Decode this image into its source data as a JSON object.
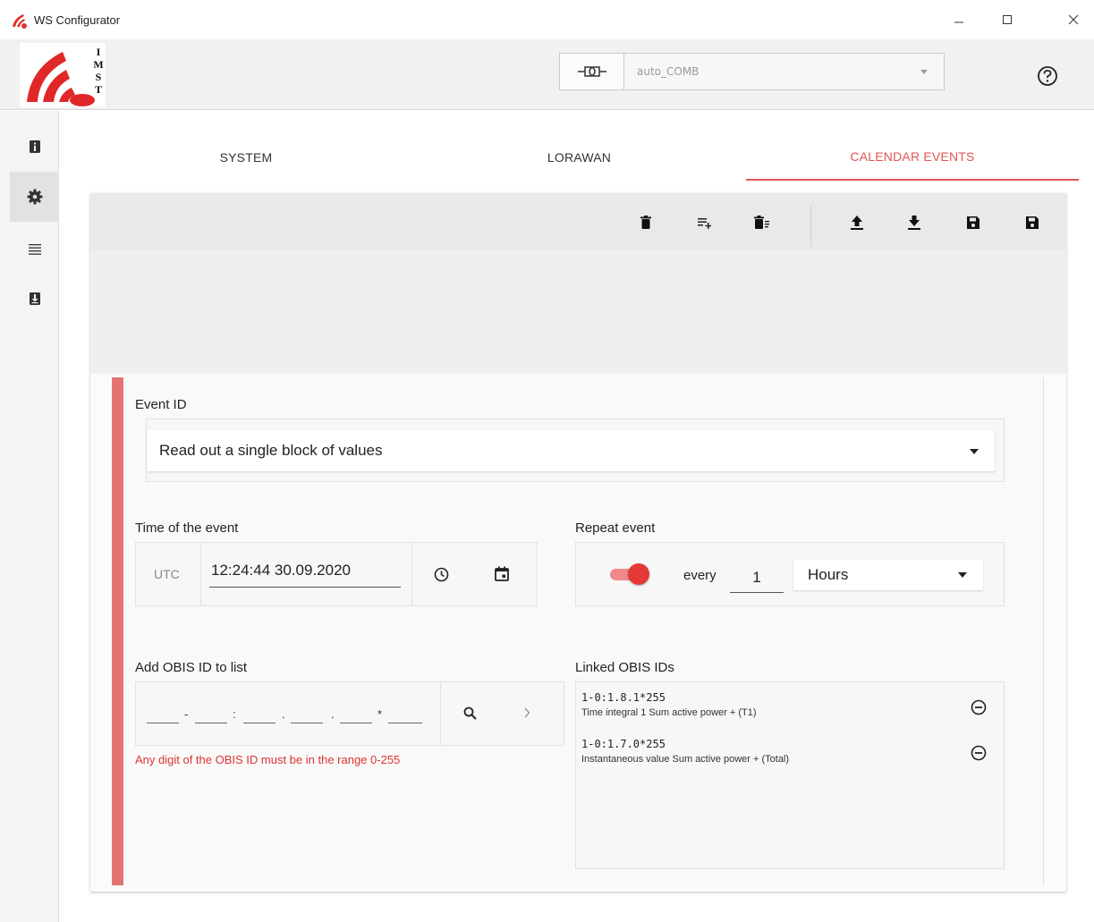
{
  "window": {
    "title": "WS Configurator",
    "controls": {
      "minimize": "—",
      "maximize": "☐",
      "close": "✕"
    }
  },
  "header": {
    "logo_letters": [
      "I",
      "M",
      "S",
      "T"
    ],
    "port_value": "auto_COMB",
    "help_icon": "help-circle-icon"
  },
  "sidebar": {
    "items": [
      {
        "name": "info",
        "icon": "info-icon",
        "active": false
      },
      {
        "name": "settings",
        "icon": "gear-icon",
        "active": true
      },
      {
        "name": "list",
        "icon": "list-icon",
        "active": false
      },
      {
        "name": "download",
        "icon": "download-box-icon",
        "active": false
      }
    ]
  },
  "tabs": [
    {
      "label": "SYSTEM",
      "active": false
    },
    {
      "label": "LORAWAN",
      "active": false
    },
    {
      "label": "CALENDAR EVENTS",
      "active": true
    }
  ],
  "toolbar": {
    "icons": [
      "delete-icon",
      "add-to-list-icon",
      "delete-all-icon",
      "upload-icon",
      "download-icon",
      "save-icon",
      "save-as-icon"
    ]
  },
  "event": {
    "event_id_label": "Event ID",
    "event_id_value": "Read out a single block of values",
    "time_label": "Time of the event",
    "timezone": "UTC",
    "time_value": "12:24:44 30.09.2020",
    "repeat_label": "Repeat event",
    "repeat_enabled": true,
    "every_label": "every",
    "every_value": "1",
    "unit_value": "Hours",
    "obis_add_label": "Add OBIS ID to list",
    "obis_separators": [
      "-",
      ":",
      ".",
      ".",
      "*"
    ],
    "obis_error": "Any digit of the OBIS ID must be in the range 0-255",
    "linked_label": "Linked OBIS IDs",
    "linked_ids": [
      {
        "id": "1-0:1.8.1*255",
        "description": "Time integral 1 Sum active power + (T1)"
      },
      {
        "id": "1-0:1.7.0*255",
        "description": "Instantaneous value Sum active power + (Total)"
      }
    ]
  },
  "colors": {
    "accent": "#e05555",
    "accent_bar": "#e57373",
    "error": "#dd3333"
  }
}
